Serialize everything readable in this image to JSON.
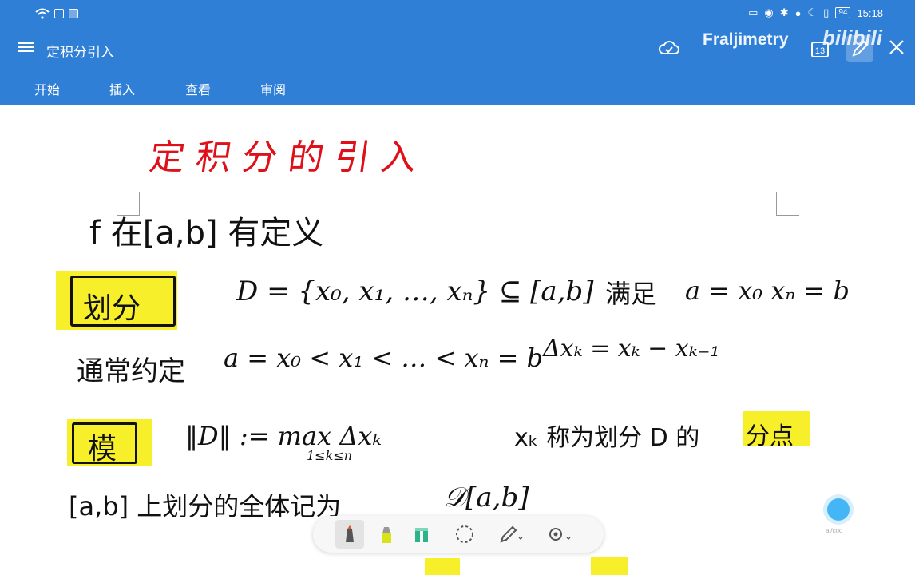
{
  "status_bar": {
    "time": "15:18",
    "battery": "94"
  },
  "app_bar": {
    "doc_title": "定积分引入",
    "watermark": "Fraljimetry",
    "watermark_brand": "bilibili",
    "page_count": "13"
  },
  "ribbon": {
    "tabs": [
      "开始",
      "插入",
      "查看",
      "审阅"
    ]
  },
  "note": {
    "title": "定积分的引入",
    "line1": "f 在[a,b] 有定义",
    "partition_label": "划分",
    "partition_def": "D = {x₀, x₁, …, xₙ} ⊆ [a,b]",
    "partition_cond_label": "满足",
    "partition_cond": "a = x₀   xₙ = b",
    "convention_label": "通常约定",
    "convention": "a = x₀ < x₁ < … < xₙ = b",
    "delta": "Δxₖ = xₖ − xₖ₋₁",
    "norm_label": "模",
    "norm_def": "‖D‖ := max Δxₖ",
    "norm_sub": "1≤k≤n",
    "point_label": "xₖ 称为划分 D 的",
    "point_highlight": "分点",
    "set_def_cn": "[a,b] 上划分的全体记为",
    "set_def": "𝒟[a,b]"
  },
  "toolbar": {
    "tools": [
      "pen-tool",
      "highlighter-tool",
      "shape-tool",
      "lasso-tool",
      "pen-settings",
      "settings"
    ]
  },
  "floating": {
    "label": "ai/coo"
  }
}
